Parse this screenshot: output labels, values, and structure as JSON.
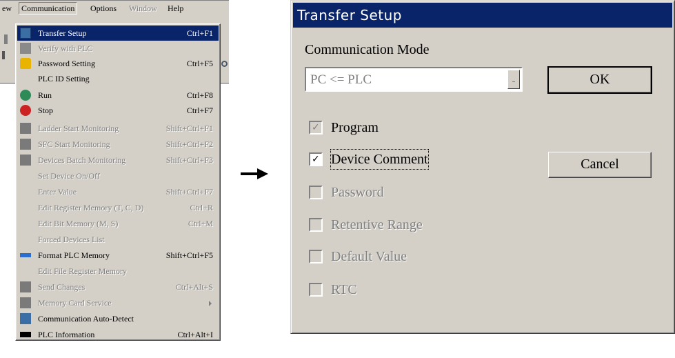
{
  "menubar": {
    "items": [
      {
        "label": "ew",
        "state": "normal"
      },
      {
        "label": "Communication",
        "state": "active"
      },
      {
        "label": "Options",
        "state": "normal"
      },
      {
        "label": "Window",
        "state": "disabled"
      },
      {
        "label": "Help",
        "state": "normal"
      }
    ]
  },
  "menu": {
    "items": [
      {
        "label": "Transfer Setup",
        "shortcut": "Ctrl+F1",
        "state": "selected",
        "icon": "transfer-icon"
      },
      {
        "label": "Verify with PLC",
        "shortcut": "",
        "state": "disabled",
        "icon": "verify-icon"
      },
      {
        "label": "Password Setting",
        "shortcut": "Ctrl+F5",
        "state": "normal",
        "icon": "lock-icon"
      },
      {
        "label": "PLC ID Setting",
        "shortcut": "",
        "state": "normal",
        "icon": ""
      },
      {
        "label": "Run",
        "shortcut": "Ctrl+F8",
        "state": "normal",
        "icon": "run-icon"
      },
      {
        "label": "Stop",
        "shortcut": "Ctrl+F7",
        "state": "normal",
        "icon": "stop-icon"
      },
      {
        "label": "Ladder Start Monitoring",
        "shortcut": "Shift+Ctrl+F1",
        "state": "disabled",
        "icon": "ladder-monitor-icon"
      },
      {
        "label": "SFC Start Monitoring",
        "shortcut": "Shift+Ctrl+F2",
        "state": "disabled",
        "icon": "sfc-monitor-icon"
      },
      {
        "label": "Devices Batch Monitoring",
        "shortcut": "Shift+Ctrl+F3",
        "state": "disabled",
        "icon": "batch-monitor-icon"
      },
      {
        "label": "Set Device On/Off",
        "shortcut": "",
        "state": "disabled",
        "icon": ""
      },
      {
        "label": "Enter Value",
        "shortcut": "Shift+Ctrl+F7",
        "state": "disabled",
        "icon": ""
      },
      {
        "label": "Edit Register Memory (T, C, D)",
        "shortcut": "Ctrl+R",
        "state": "disabled",
        "icon": ""
      },
      {
        "label": "Edit Bit Memory (M, S)",
        "shortcut": "Ctrl+M",
        "state": "disabled",
        "icon": ""
      },
      {
        "label": "Forced Devices List",
        "shortcut": "",
        "state": "disabled",
        "icon": ""
      },
      {
        "label": "Format PLC Memory",
        "shortcut": "Shift+Ctrl+F5",
        "state": "normal",
        "icon": "format-icon"
      },
      {
        "label": "Edit File Register Memory",
        "shortcut": "",
        "state": "disabled",
        "icon": ""
      },
      {
        "label": "Send Changes",
        "shortcut": "Ctrl+Alt+S",
        "state": "disabled",
        "icon": "send-icon"
      },
      {
        "label": "Memory Card Service",
        "shortcut": "",
        "state": "disabled",
        "icon": "memory-card-icon",
        "submenu": true
      },
      {
        "label": "Communication Auto-Detect",
        "shortcut": "",
        "state": "normal",
        "icon": "auto-detect-icon"
      },
      {
        "label": "PLC Information",
        "shortcut": "Ctrl+Alt+I",
        "state": "normal",
        "icon": "info-icon"
      }
    ]
  },
  "dialog": {
    "title": "Transfer Setup",
    "mode_label": "Communication Mode",
    "mode_value": "PC <= PLC",
    "ok_label": "OK",
    "cancel_label": "Cancel",
    "checkboxes": [
      {
        "label": "Program",
        "checked": true,
        "enabled": false
      },
      {
        "label": "Device Comment",
        "checked": true,
        "enabled": true
      },
      {
        "label": "Password",
        "checked": false,
        "enabled": false
      },
      {
        "label": "Retentive Range",
        "checked": false,
        "enabled": false
      },
      {
        "label": "Default Value",
        "checked": false,
        "enabled": false
      },
      {
        "label": "RTC",
        "checked": false,
        "enabled": false
      }
    ]
  },
  "colors": {
    "selection": "#0a246a",
    "face": "#d4d0c8",
    "disabled_text": "#808080"
  }
}
